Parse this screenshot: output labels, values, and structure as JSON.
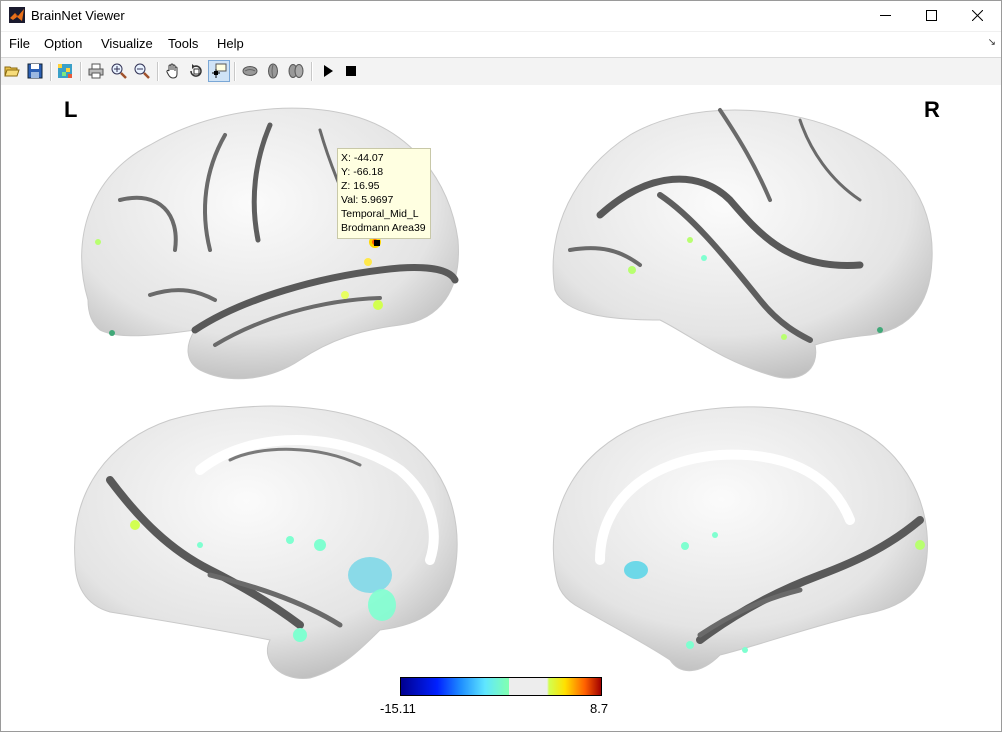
{
  "window": {
    "title": "BrainNet Viewer"
  },
  "menu": {
    "items": [
      "File",
      "Option",
      "Visualize",
      "Tools",
      "Help"
    ]
  },
  "toolbar": {
    "buttons": [
      "open-icon",
      "save-icon",
      "colormap-icon",
      "print-icon",
      "zoom-in-icon",
      "zoom-out-icon",
      "pan-icon",
      "rotate-icon",
      "data-cursor-icon",
      "lateral-view-icon",
      "medial-view-icon",
      "full-view-icon",
      "play-icon",
      "stop-icon"
    ],
    "active": "data-cursor-icon"
  },
  "view": {
    "left_label": "L",
    "right_label": "R"
  },
  "datatip": {
    "x": "X: -44.07",
    "y": "Y: -66.18",
    "z": "Z: 16.95",
    "val": "Val: 5.9697",
    "region": "Temporal_Mid_L",
    "brodmann": "Brodmann Area39"
  },
  "colorbar": {
    "min": "-15.11",
    "max": "8.7"
  },
  "colors": {
    "surface": "#ededed",
    "sulcus": "#5a5a5a",
    "positive": "#ffd800",
    "negative": "#7fffd0"
  }
}
